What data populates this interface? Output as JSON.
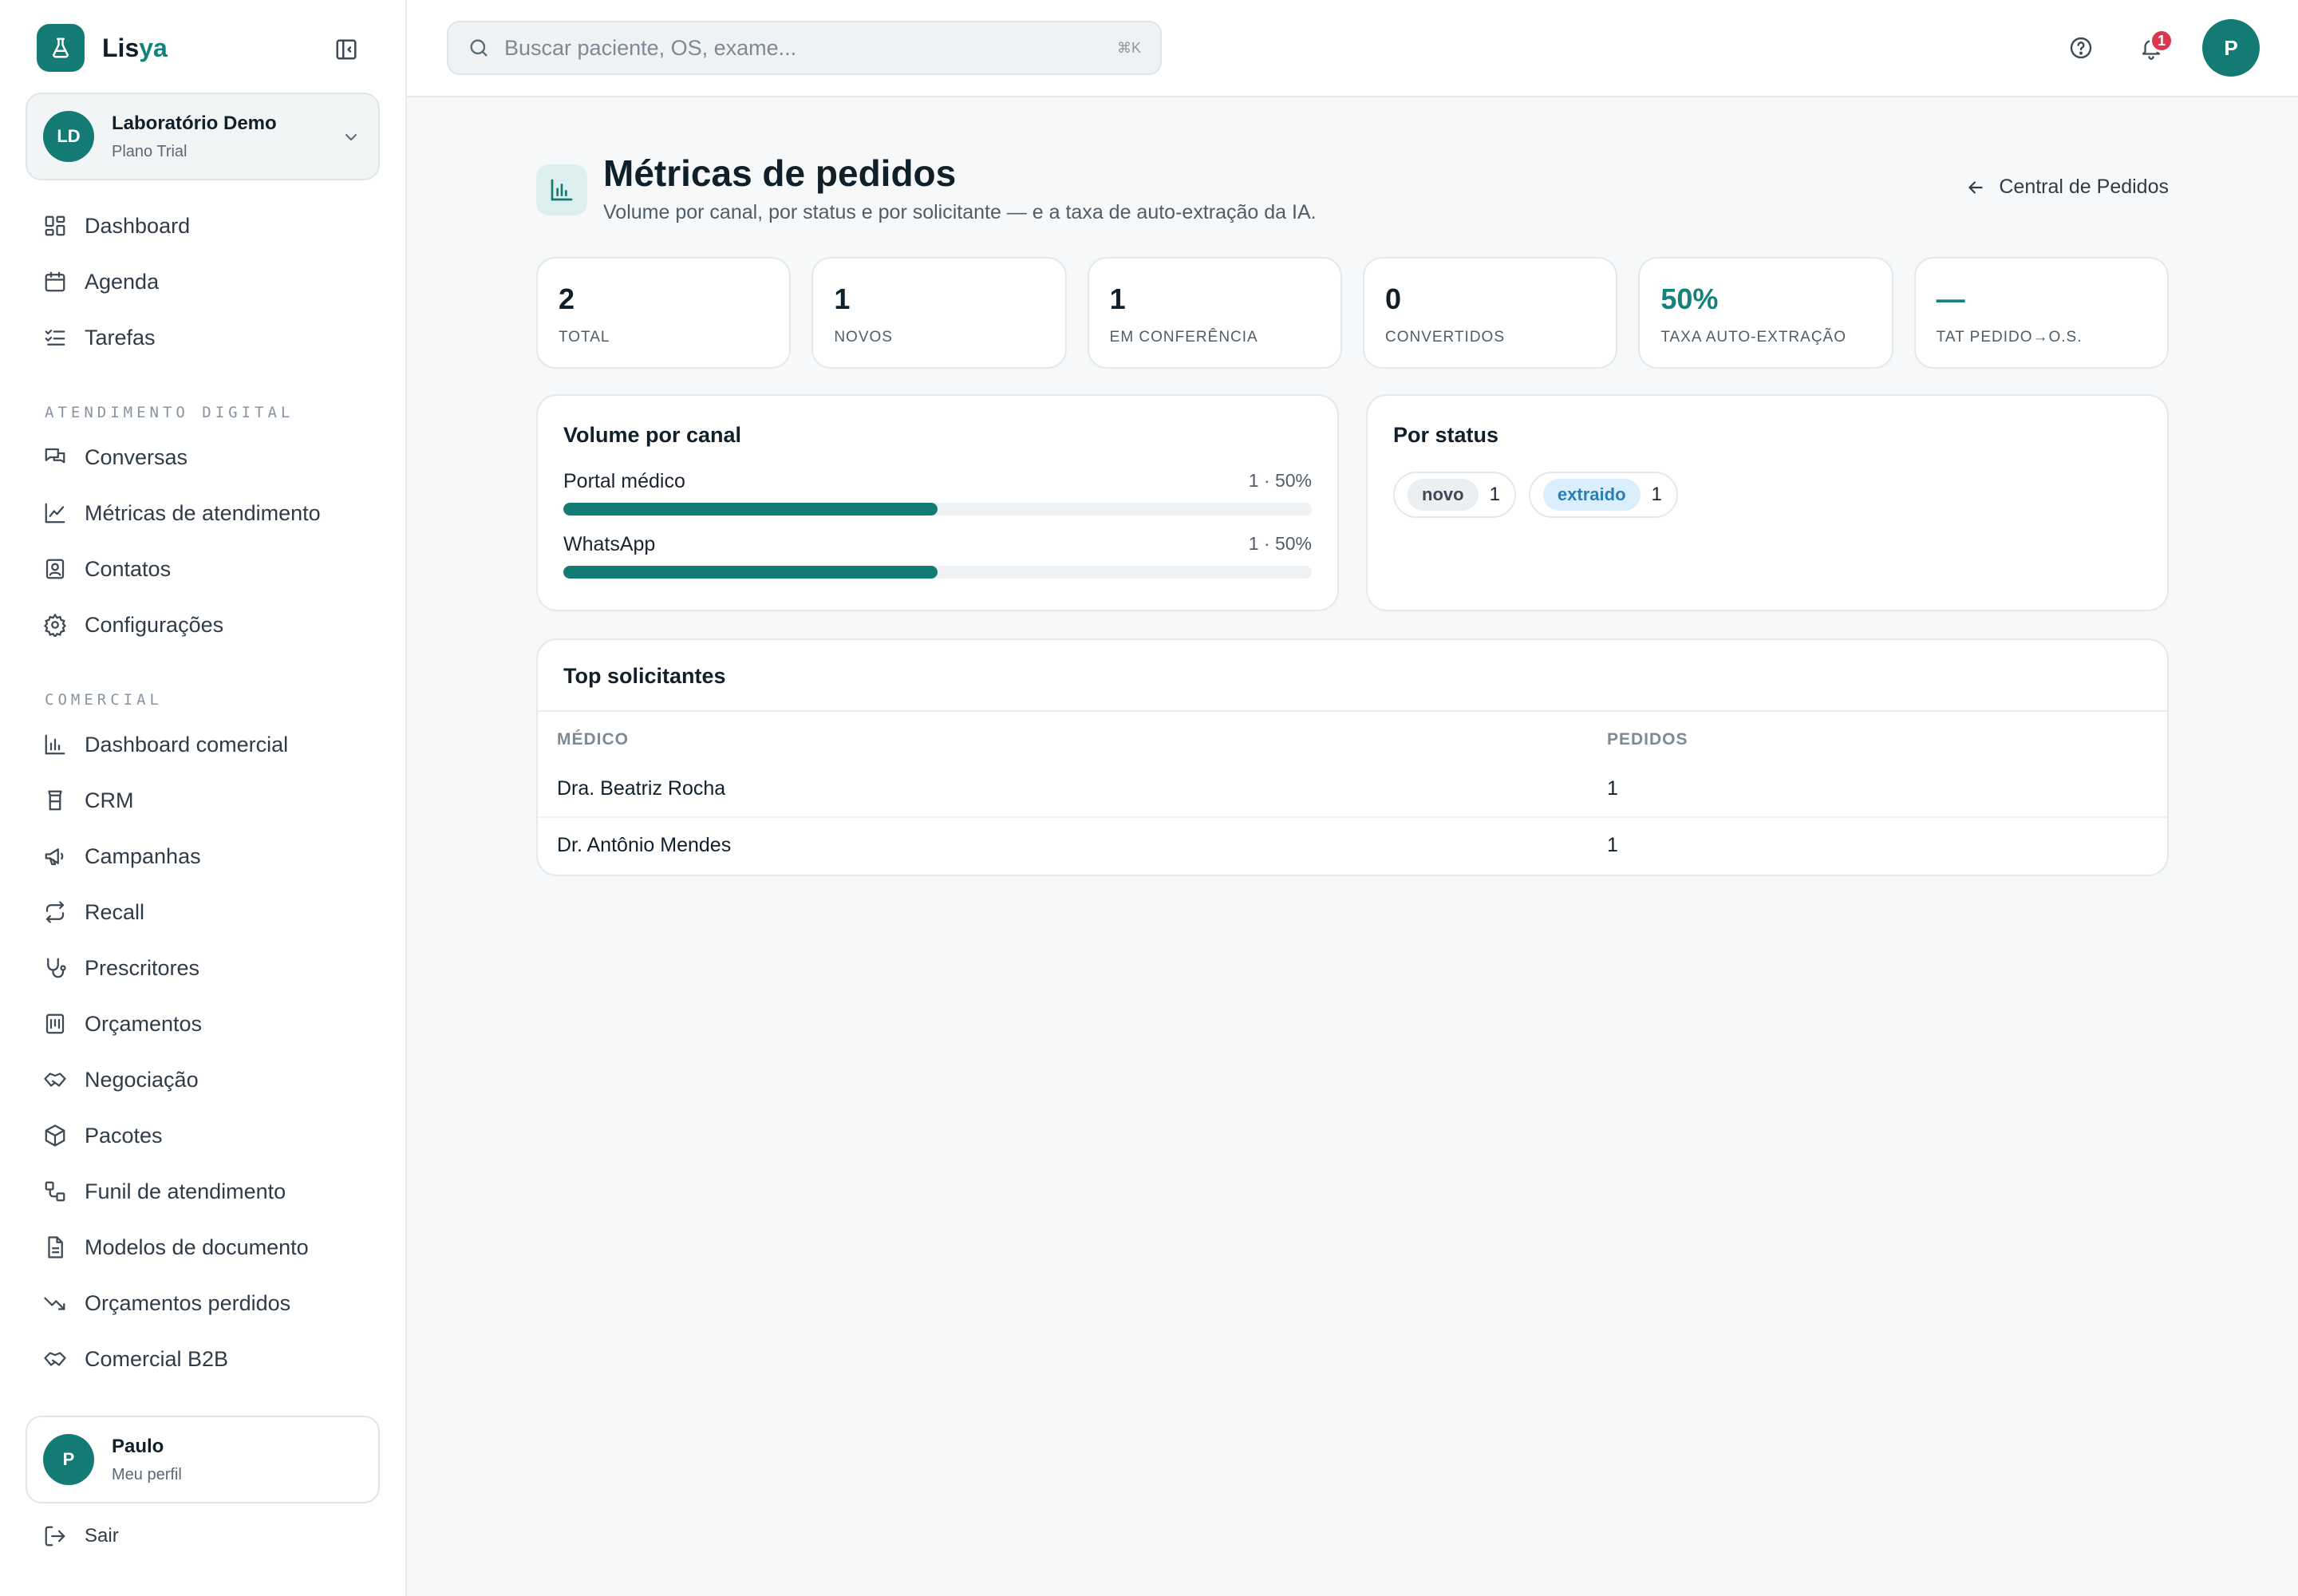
{
  "brand": {
    "name_main": "Lis",
    "name_accent": "ya"
  },
  "org": {
    "initials": "LD",
    "name": "Laboratório Demo",
    "plan": "Plano Trial"
  },
  "nav_main": [
    {
      "label": "Dashboard",
      "icon": "dashboard-icon"
    },
    {
      "label": "Agenda",
      "icon": "calendar-icon"
    },
    {
      "label": "Tarefas",
      "icon": "tasks-icon"
    }
  ],
  "section_digital": "ATENDIMENTO DIGITAL",
  "nav_digital": [
    {
      "label": "Conversas",
      "icon": "chat-icon"
    },
    {
      "label": "Métricas de atendimento",
      "icon": "line-chart-icon"
    },
    {
      "label": "Contatos",
      "icon": "contact-icon"
    },
    {
      "label": "Configurações",
      "icon": "gear-icon"
    }
  ],
  "section_comercial": "COMERCIAL",
  "nav_comercial": [
    {
      "label": "Dashboard comercial",
      "icon": "bar-chart-icon"
    },
    {
      "label": "CRM",
      "icon": "crm-icon"
    },
    {
      "label": "Campanhas",
      "icon": "megaphone-icon"
    },
    {
      "label": "Recall",
      "icon": "repeat-icon"
    },
    {
      "label": "Prescritores",
      "icon": "stethoscope-icon"
    },
    {
      "label": "Orçamentos",
      "icon": "budget-icon"
    },
    {
      "label": "Negociação",
      "icon": "handshake-icon"
    },
    {
      "label": "Pacotes",
      "icon": "package-icon"
    },
    {
      "label": "Funil de atendimento",
      "icon": "workflow-icon"
    },
    {
      "label": "Modelos de documento",
      "icon": "document-icon"
    },
    {
      "label": "Orçamentos perdidos",
      "icon": "trending-down-icon"
    },
    {
      "label": "Comercial B2B",
      "icon": "handshake-icon"
    }
  ],
  "profile": {
    "initial": "P",
    "name": "Paulo",
    "subtitle": "Meu perfil"
  },
  "logout_label": "Sair",
  "search": {
    "placeholder": "Buscar paciente, OS, exame...",
    "shortcut": "⌘K"
  },
  "notifications": {
    "count": "1"
  },
  "user": {
    "initial": "P"
  },
  "page": {
    "title": "Métricas de pedidos",
    "subtitle": "Volume por canal, por status e por solicitante — e a taxa de auto-extração da IA.",
    "back_link": "Central de Pedidos"
  },
  "kpis": [
    {
      "value": "2",
      "label": "TOTAL"
    },
    {
      "value": "1",
      "label": "NOVOS"
    },
    {
      "value": "1",
      "label": "EM CONFERÊNCIA"
    },
    {
      "value": "0",
      "label": "CONVERTIDOS"
    },
    {
      "value": "50%",
      "label": "TAXA AUTO-EXTRAÇÃO"
    },
    {
      "value": "—",
      "label": "TAT PEDIDO→O.S."
    }
  ],
  "accent_color": "#137a74",
  "volume": {
    "title": "Volume por canal",
    "channels": [
      {
        "name": "Portal médico",
        "stat": "1 · 50%",
        "share": 0.5
      },
      {
        "name": "WhatsApp",
        "stat": "1 · 50%",
        "share": 0.5
      }
    ]
  },
  "status": {
    "title": "Por status",
    "items": [
      {
        "tag": "novo",
        "count": "1"
      },
      {
        "tag": "extraido",
        "count": "1"
      }
    ]
  },
  "top": {
    "title": "Top solicitantes",
    "headers": [
      "MÉDICO",
      "PEDIDOS"
    ],
    "rows": [
      {
        "name": "Dra. Beatriz Rocha",
        "count": "1"
      },
      {
        "name": "Dr. Antônio Mendes",
        "count": "1"
      }
    ]
  }
}
